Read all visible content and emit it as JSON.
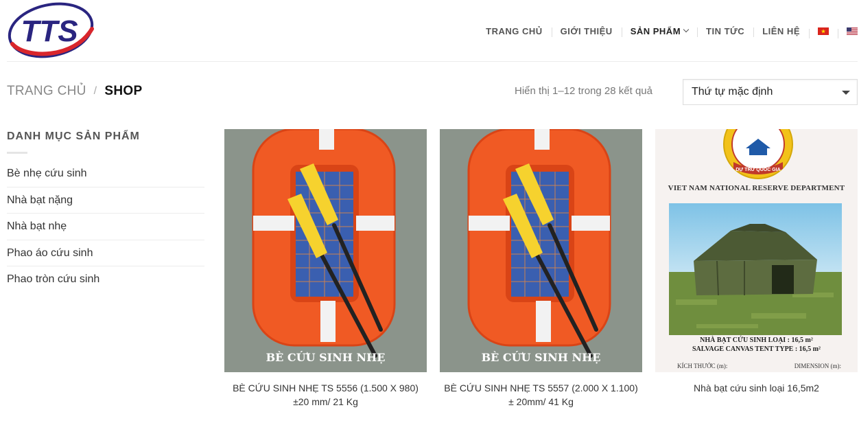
{
  "brand": {
    "logo_text": "TTS",
    "logo_color": "#2a2580",
    "logo_accent": "#d9262c"
  },
  "nav": {
    "items": [
      {
        "label": "TRANG CHỦ"
      },
      {
        "label": "GIỚI THIỆU"
      },
      {
        "label": "SẢN PHẨM"
      },
      {
        "label": "TIN TỨC"
      },
      {
        "label": "LIÊN HỆ"
      }
    ],
    "icons": {
      "dropdown": "chevron-down-icon",
      "lang_vi": "flag-vietnam-icon",
      "lang_en": "flag-usa-icon"
    }
  },
  "breadcrumb": {
    "home": "TRANG CHỦ",
    "separator": "/",
    "current": "SHOP"
  },
  "results": {
    "text": "Hiển thị 1–12 trong 28 kết quả"
  },
  "sort": {
    "selected": "Thứ tự mặc định"
  },
  "sidebar": {
    "title": "DANH MỤC SẢN PHẨM",
    "categories": [
      {
        "label": "Bè nhẹ cứu sinh"
      },
      {
        "label": "Nhà bạt nặng"
      },
      {
        "label": "Nhà bạt nhẹ"
      },
      {
        "label": "Phao áo cứu sinh"
      },
      {
        "label": "Phao tròn cứu sinh"
      }
    ]
  },
  "products": [
    {
      "title": "BÈ CỨU SINH NHẸ TS 5556 (1.500 X 980) ±20 mm/ 21 Kg",
      "image_caption": "BÈ CỨU SINH NHẸ"
    },
    {
      "title": "BÈ CỨU SINH NHẸ TS 5557 (2.000 X 1.100) ± 20mm/ 41 Kg",
      "image_caption": "BÈ CỨU SINH NHẸ"
    },
    {
      "title": "Nhà bạt cứu sinh loại 16,5m2",
      "image_header": "VIET NAM NATIONAL RESERVE DEPARTMENT",
      "seal_text": "DỰ TRỮ QUỐC GIA",
      "image_line1": "NHÀ BẠT CỨU SINH LOẠI : 16,5 m²",
      "image_line2": "SALVAGE CANVAS TENT TYPE : 16,5 m²",
      "image_dim_left": "KÍCH THƯỚC (m):",
      "image_dim_right": "DIMENSION (m):"
    }
  ],
  "colors": {
    "raft_orange": "#f05a24",
    "paddle_yellow": "#f6d22e",
    "nav_text": "#555555",
    "border": "#dddddd"
  }
}
